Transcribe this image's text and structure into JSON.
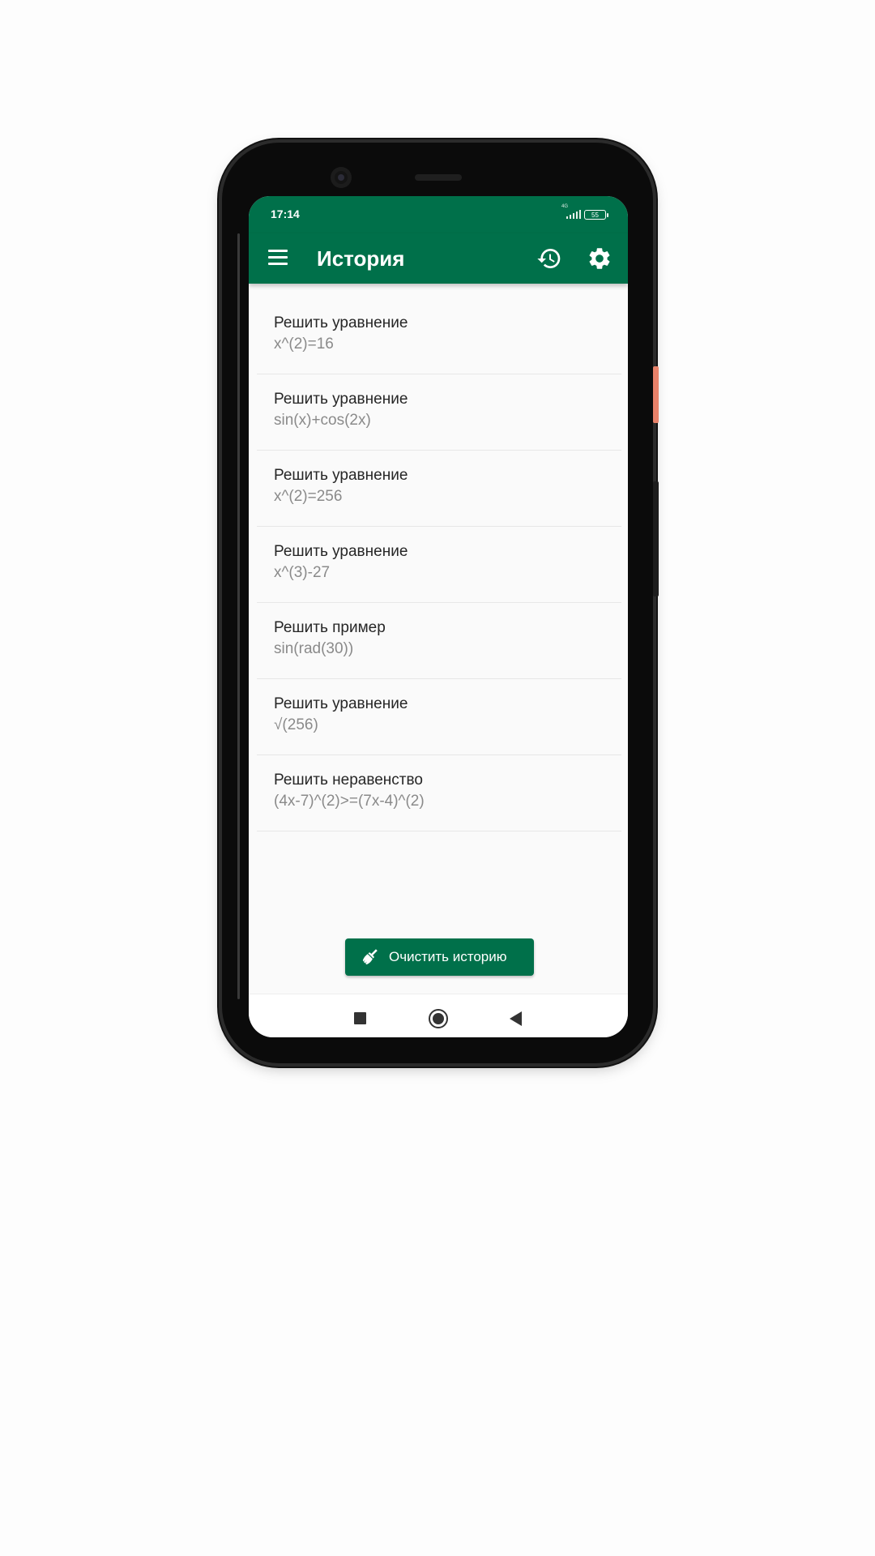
{
  "status_bar": {
    "time": "17:14",
    "network_label": "4G",
    "battery": "55"
  },
  "app_bar": {
    "title": "История"
  },
  "history_items": [
    {
      "title": "Решить уравнение",
      "expression": "x^(2)=16"
    },
    {
      "title": "Решить уравнение",
      "expression": "sin(x)+cos(2x)"
    },
    {
      "title": "Решить уравнение",
      "expression": "x^(2)=256"
    },
    {
      "title": "Решить уравнение",
      "expression": "x^(3)-27"
    },
    {
      "title": "Решить пример",
      "expression": "sin(rad(30))"
    },
    {
      "title": "Решить уравнение",
      "expression": "√(256)"
    },
    {
      "title": "Решить неравенство",
      "expression": "(4x-7)^(2)>=(7x-4)^(2)"
    }
  ],
  "clear_button": {
    "label": "Очистить историю"
  },
  "colors": {
    "primary": "#00704a",
    "background": "#fafafa",
    "item_title": "#262626",
    "item_expression": "#8a8a8a"
  },
  "icons": {
    "menu": "menu-icon",
    "history": "history-icon",
    "settings": "gear-icon",
    "clear": "broom-icon",
    "nav_recent": "square-icon",
    "nav_home": "circle-icon",
    "nav_back": "triangle-back-icon"
  }
}
